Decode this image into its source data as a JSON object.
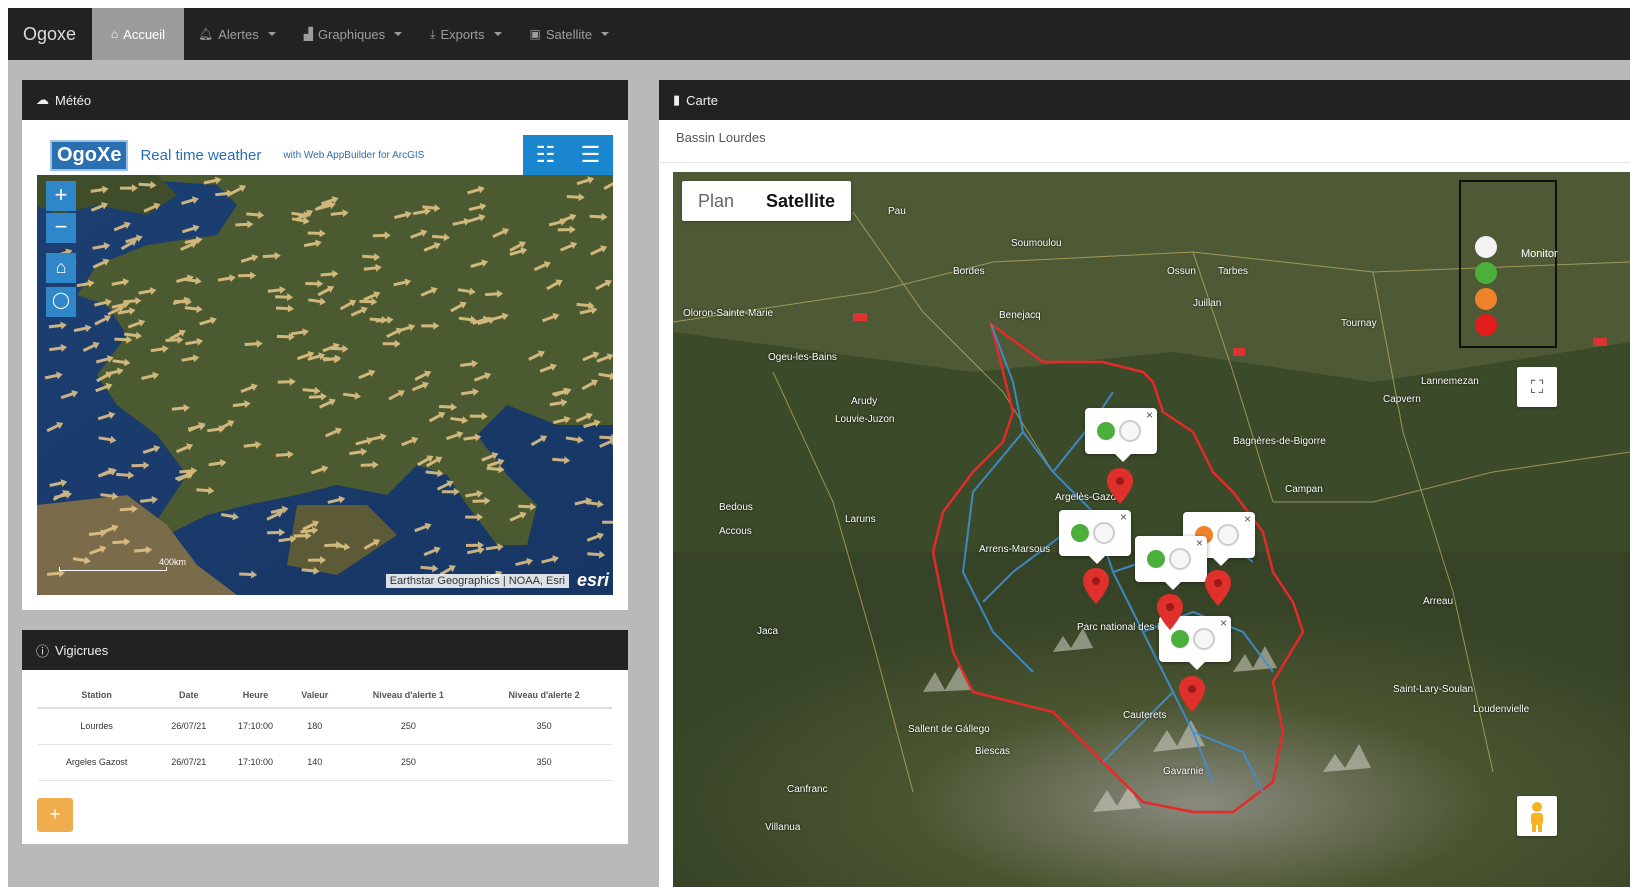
{
  "navbar": {
    "brand": "Ogoxe",
    "items": [
      {
        "label": "Accueil",
        "icon": "home-icon",
        "active": true
      },
      {
        "label": "Alertes",
        "icon": "bell-icon",
        "dropdown": true
      },
      {
        "label": "Graphiques",
        "icon": "chart-icon",
        "dropdown": true
      },
      {
        "label": "Exports",
        "icon": "download-icon",
        "dropdown": true
      },
      {
        "label": "Satellite",
        "icon": "image-icon",
        "dropdown": true
      }
    ]
  },
  "meteo": {
    "title": "Météo",
    "icon": "cloud-icon",
    "widget": {
      "logo": "OgoXe",
      "title": "Real time weather",
      "subtitle": "with Web AppBuilder for ArcGIS",
      "zoom_in": "+",
      "zoom_out": "−",
      "scale_label": "400km",
      "attribution": "Earthstar Geographics | NOAA, Esri",
      "esri": "esri"
    }
  },
  "vigicrues": {
    "title": "Vigicrues",
    "icon": "info-icon",
    "columns": [
      "Station",
      "Date",
      "Heure",
      "Valeur",
      "Niveau d'alerte 1",
      "Niveau d'alerte 2"
    ],
    "rows": [
      [
        "Lourdes",
        "26/07/21",
        "17:10:00",
        "180",
        "250",
        "350"
      ],
      [
        "Argeles Gazost",
        "26/07/21",
        "17:10:00",
        "140",
        "250",
        "350"
      ]
    ],
    "add_label": "+"
  },
  "carte": {
    "title": "Carte",
    "icon": "map-icon",
    "subtitle": "Bassin Lourdes",
    "toggle": {
      "plan": "Plan",
      "satellite": "Satellite"
    },
    "legend_text": "Monitor",
    "legend_colors": [
      "#f2f2f2",
      "#4caf3c",
      "#f0832a",
      "#e21c1c"
    ],
    "places": [
      {
        "name": "Pau"
      },
      {
        "name": "Tarbes"
      },
      {
        "name": "Bordes"
      },
      {
        "name": "Juillan"
      },
      {
        "name": "Oloron-Sainte-Marie"
      },
      {
        "name": "Ogeu-les-Bains"
      },
      {
        "name": "Arudy"
      },
      {
        "name": "Louvie-Juzon"
      },
      {
        "name": "Bedous"
      },
      {
        "name": "Accous"
      },
      {
        "name": "Laruns"
      },
      {
        "name": "Argelès-Gazost"
      },
      {
        "name": "Arrens-Marsous"
      },
      {
        "name": "Parc national des Pyrénées"
      },
      {
        "name": "Lannemezan"
      },
      {
        "name": "Capvern"
      },
      {
        "name": "Bagnères-de-Bigorre"
      },
      {
        "name": "Campan"
      },
      {
        "name": "Arreau"
      },
      {
        "name": "Saint-Lary-Soulan"
      },
      {
        "name": "Loudenvielle"
      },
      {
        "name": "Sallent de Gállego"
      },
      {
        "name": "Biescas"
      },
      {
        "name": "Canfranc"
      },
      {
        "name": "Jaca"
      },
      {
        "name": "Villanua"
      },
      {
        "name": "Gavarnie"
      },
      {
        "name": "Cauterets"
      },
      {
        "name": "Soumoulou"
      },
      {
        "name": "Tournay"
      },
      {
        "name": "Benejacq"
      },
      {
        "name": "Ossun"
      }
    ],
    "stations": [
      {
        "status": "green"
      },
      {
        "status": "green"
      },
      {
        "status": "green"
      },
      {
        "status": "orange"
      },
      {
        "status": "green"
      }
    ]
  }
}
